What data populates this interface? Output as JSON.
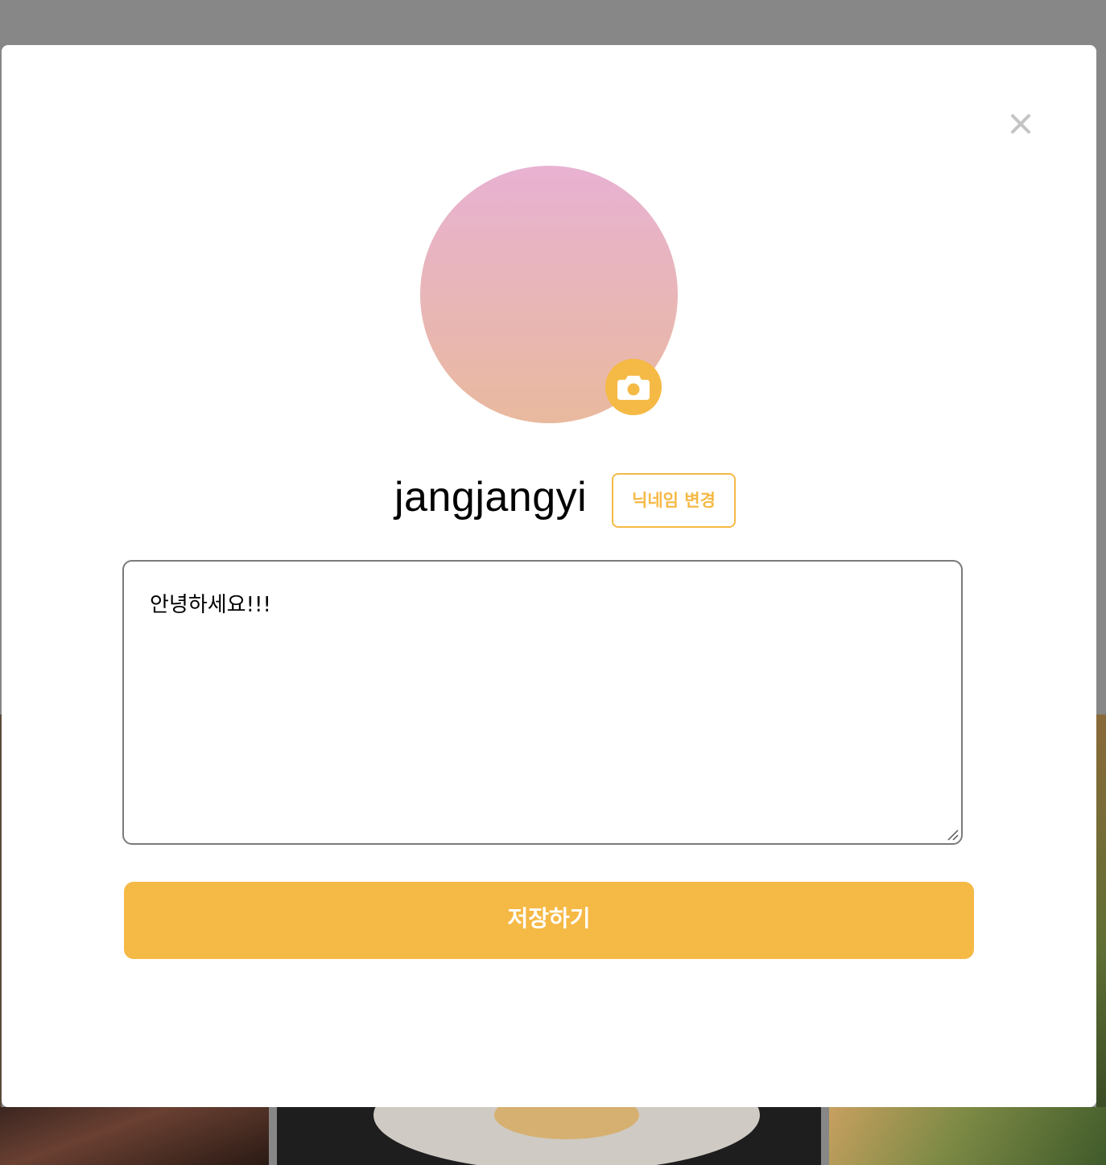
{
  "profile_modal": {
    "nickname": "jangjangyi",
    "change_nickname_label": "닉네임 변경",
    "bio_value": "안녕하세요!!!",
    "save_label": "저장하기",
    "close_icon": "close-icon",
    "camera_icon": "camera-icon"
  },
  "colors": {
    "accent": "#f5b945",
    "avatar_gradient_top": "#e8b2d2",
    "avatar_gradient_bottom": "#e9b99e",
    "overlay": "#878787"
  }
}
